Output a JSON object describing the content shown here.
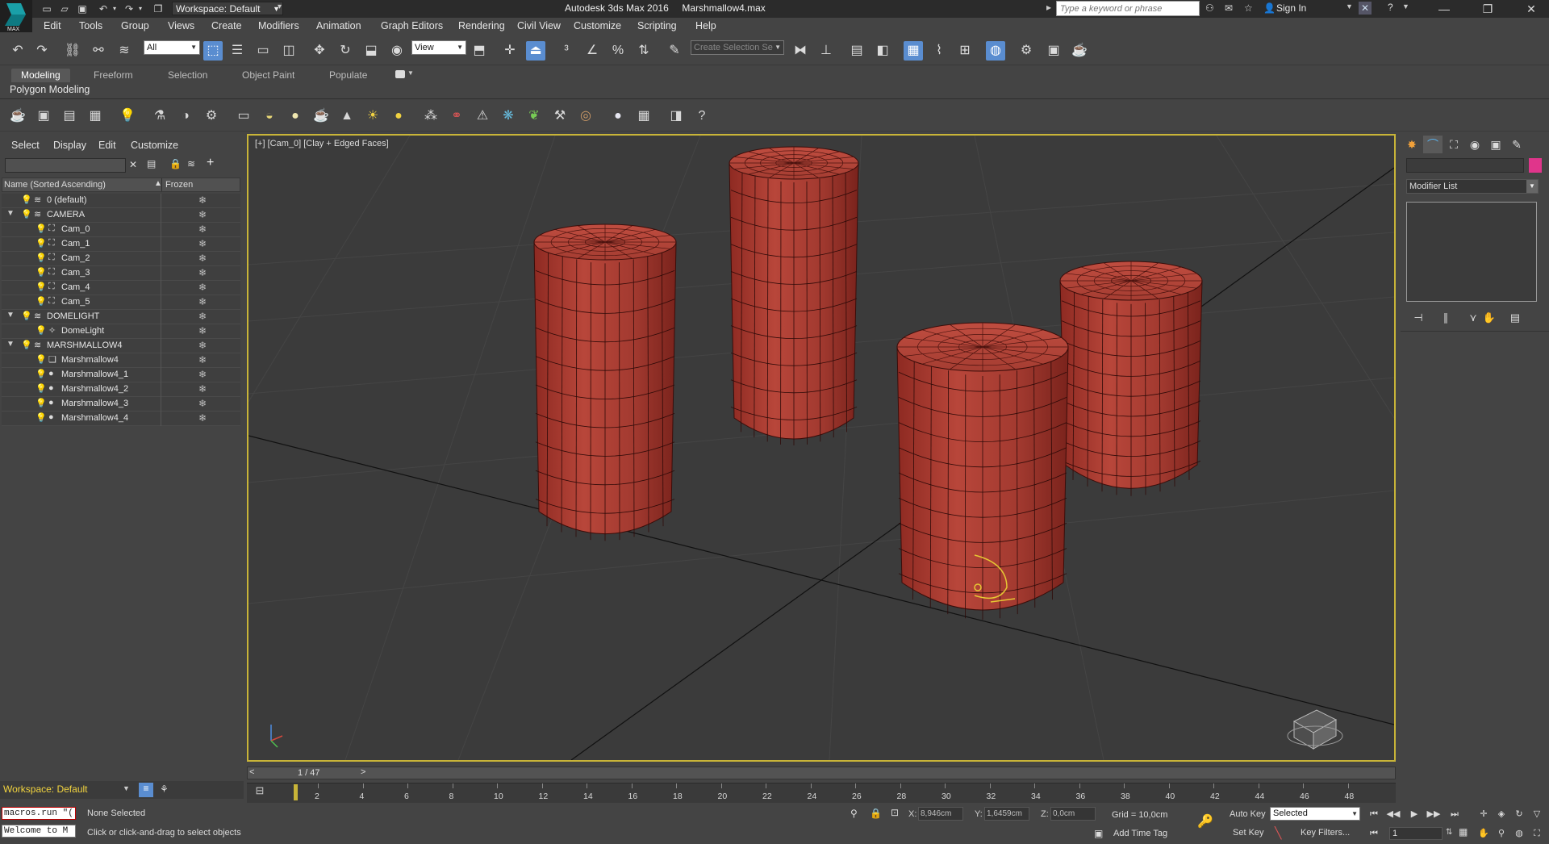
{
  "window": {
    "app_title": "Autodesk 3ds Max 2016",
    "file_name": "Marshmallow4.max",
    "workspace_label": "Workspace: Default",
    "search_placeholder": "Type a keyword or phrase",
    "sign_in": "Sign In",
    "logo_text": "MAX"
  },
  "menubar": {
    "items": [
      "Edit",
      "Tools",
      "Group",
      "Views",
      "Create",
      "Modifiers",
      "Animation",
      "Graph Editors",
      "Rendering",
      "Civil View",
      "Customize",
      "Scripting",
      "Help"
    ]
  },
  "main_toolbar": {
    "selection_filter": "All",
    "reference_coord": "View",
    "selection_set_placeholder": "Create Selection Se"
  },
  "ribbon": {
    "tabs": [
      "Modeling",
      "Freeform",
      "Selection",
      "Object Paint",
      "Populate"
    ],
    "active_tab": "Modeling",
    "panel_label": "Polygon Modeling"
  },
  "scene_explorer": {
    "menu": [
      "Select",
      "Display",
      "Edit",
      "Customize"
    ],
    "col_name": "Name (Sorted Ascending)",
    "col_frozen": "Frozen",
    "rows": [
      {
        "label": "0 (default)",
        "type": "layer",
        "depth": 0,
        "expander": ""
      },
      {
        "label": "CAMERA",
        "type": "layer",
        "depth": 0,
        "expander": "▼"
      },
      {
        "label": "Cam_0",
        "type": "camera",
        "depth": 1,
        "expander": ""
      },
      {
        "label": "Cam_1",
        "type": "camera",
        "depth": 1,
        "expander": ""
      },
      {
        "label": "Cam_2",
        "type": "camera",
        "depth": 1,
        "expander": ""
      },
      {
        "label": "Cam_3",
        "type": "camera",
        "depth": 1,
        "expander": ""
      },
      {
        "label": "Cam_4",
        "type": "camera",
        "depth": 1,
        "expander": ""
      },
      {
        "label": "Cam_5",
        "type": "camera",
        "depth": 1,
        "expander": ""
      },
      {
        "label": "DOMELIGHT",
        "type": "layer",
        "depth": 0,
        "expander": "▼"
      },
      {
        "label": "DomeLight",
        "type": "light",
        "depth": 1,
        "expander": ""
      },
      {
        "label": "MARSHMALLOW4",
        "type": "layer",
        "depth": 0,
        "expander": "▼"
      },
      {
        "label": "Marshmallow4",
        "type": "group",
        "depth": 1,
        "expander": ""
      },
      {
        "label": "Marshmallow4_1",
        "type": "mesh",
        "depth": 1,
        "expander": ""
      },
      {
        "label": "Marshmallow4_2",
        "type": "mesh",
        "depth": 1,
        "expander": ""
      },
      {
        "label": "Marshmallow4_3",
        "type": "mesh",
        "depth": 1,
        "expander": ""
      },
      {
        "label": "Marshmallow4_4",
        "type": "mesh",
        "depth": 1,
        "expander": ""
      }
    ],
    "footer_workspace": "Workspace: Default"
  },
  "viewport": {
    "label": "[+] [Cam_0] [Clay + Edged Faces]",
    "border_color": "#c8b438",
    "object_color": "#b03a30",
    "objects": [
      "Marshmallow4_1",
      "Marshmallow4_2",
      "Marshmallow4_3",
      "Marshmallow4_4"
    ]
  },
  "command_panel": {
    "modifier_list": "Modifier List",
    "object_color": "#e0358b"
  },
  "time_slider": {
    "frame_display": "1 / 47",
    "prev": "<",
    "next": ">",
    "ticks": [
      "2",
      "4",
      "6",
      "8",
      "10",
      "12",
      "14",
      "16",
      "18",
      "20",
      "22",
      "24",
      "26",
      "28",
      "30",
      "32",
      "34",
      "36",
      "38",
      "40",
      "42",
      "44",
      "46",
      "48"
    ]
  },
  "status": {
    "maxscript_line1": "macros.run \"(",
    "maxscript_line2": "Welcome to M",
    "selection": "None Selected",
    "prompt": "Click or click-and-drag to select objects",
    "x_label": "X:",
    "x_value": "8,946cm",
    "y_label": "Y:",
    "y_value": "1,6459cm",
    "z_label": "Z:",
    "z_value": "0,0cm",
    "grid": "Grid = 10,0cm",
    "add_time_tag": "Add Time Tag",
    "auto_key": "Auto Key",
    "set_key": "Set Key",
    "selected_option": "Selected",
    "key_filters": "Key Filters...",
    "current_frame": "1"
  }
}
